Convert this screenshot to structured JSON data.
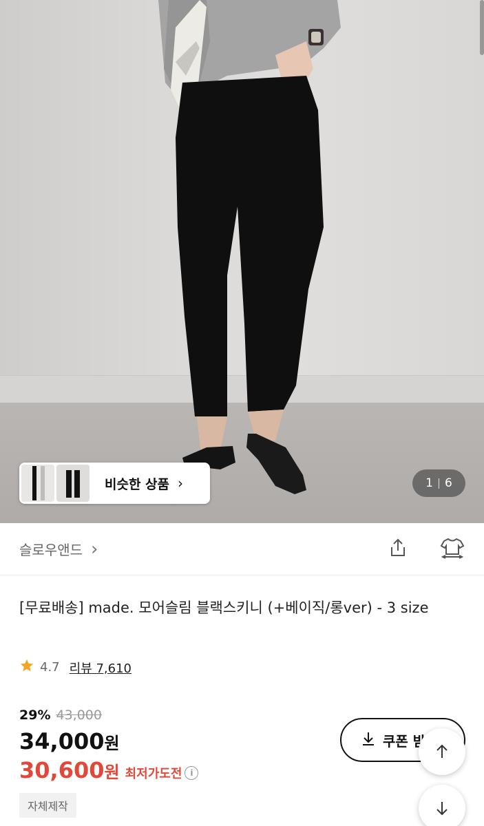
{
  "gallery": {
    "current": "1",
    "total": "6",
    "similar_label": "비슷한 상품",
    "similar_chevron": "›"
  },
  "brand": {
    "name": "슬로우앤드",
    "chevron": "›",
    "share_icon": "share-icon",
    "fitting_icon": "shirt-fitting-icon"
  },
  "product": {
    "title": "[무료배송] made. 모어슬림 블랙스키니 (+베이직/롱ver) - 3 size",
    "rating": "4.7",
    "review_label": "리뷰 7,610",
    "discount_rate": "29%",
    "original_price": "43,000",
    "price_number": "34,000",
    "price_unit": "원",
    "best_price_number": "30,600",
    "best_price_unit": "원",
    "best_price_note": "최저가도전",
    "info_icon": "i",
    "badge": "자체제작"
  },
  "actions": {
    "coupon_label": "쿠폰 받"
  },
  "colors": {
    "accent_red": "#e0493a",
    "star": "#f3a526"
  }
}
